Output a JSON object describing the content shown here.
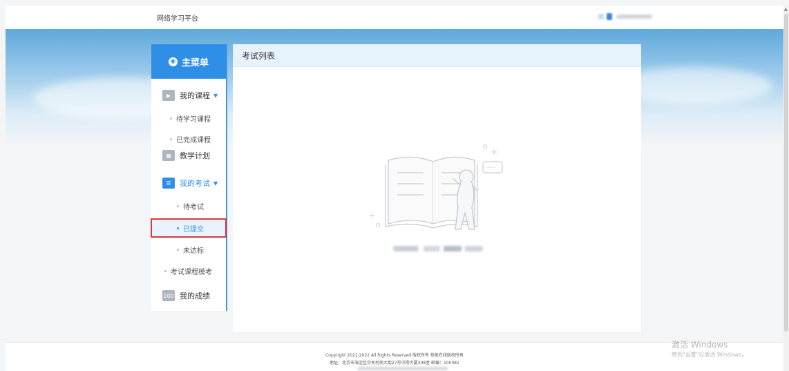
{
  "header": {
    "brand": "网络学习平台"
  },
  "sidebar": {
    "menu_title": "主菜单",
    "groups": [
      {
        "label": "我的课程",
        "icon": "video-icon"
      },
      {
        "label": "教学计划",
        "icon": "calendar-icon"
      },
      {
        "label": "我的考试",
        "icon": "exam-icon"
      },
      {
        "label": "我的成绩",
        "icon": "score-icon"
      }
    ],
    "course_sub": [
      "待学习课程",
      "已完成课程"
    ],
    "exam_sub": [
      "待考试",
      "已提交",
      "未达标"
    ],
    "other_sub": "考试课程模考",
    "selected": "已提交"
  },
  "main": {
    "title": "考试列表"
  },
  "footer": {
    "copyright": "Copyright 2021-2022 All Rights Reserved 版权所有 技能在线版权所有",
    "address": "地址：北京市海淀区中关村南大街27号中扬大厦308室 邮编：100081"
  },
  "watermark": {
    "title": "激活 Windows",
    "subtitle": "转到\"设置\"以激活 Windows。"
  },
  "colors": {
    "accent": "#2f8fe6",
    "selected_outline": "#d9393a"
  }
}
